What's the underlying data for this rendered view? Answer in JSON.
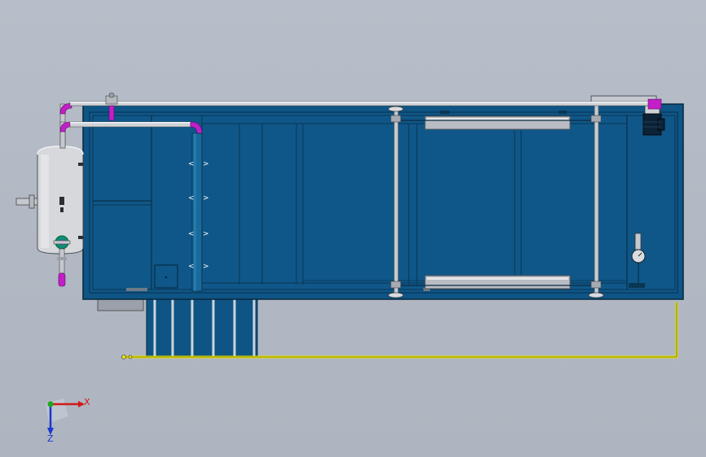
{
  "viewport": {
    "background": "#b3bac5"
  },
  "colors": {
    "tank_body": "#0e5585",
    "tank_edge": "#093c60",
    "tank_lines": "#06263c",
    "pipe_silver": "#c9ccd1",
    "pipe_magenta": "#c21fc8",
    "drain_yellow": "#e8e300",
    "vessel": "#d6d8dc",
    "axis_x": "#d11a1a",
    "axis_y": "#1ea81e",
    "axis_z": "#1a36d1"
  },
  "axis_triad": {
    "x_label": "X",
    "z_label": "Z",
    "x_icon": "x-axis-arrow-icon",
    "z_icon": "z-axis-arrow-icon"
  },
  "components": {
    "tank": "tank-body-icon",
    "pressure_vessel": "pressure-vessel-icon",
    "top_pipe": "top-pipe-icon",
    "inner_pipe": "inner-pipe-icon",
    "diffuser_column": "diffuser-column-icon",
    "scraper_frame": "scraper-frame-icon",
    "motor": "motor-icon",
    "gauge": "gauge-icon",
    "drain_line": "drain-line-icon"
  }
}
